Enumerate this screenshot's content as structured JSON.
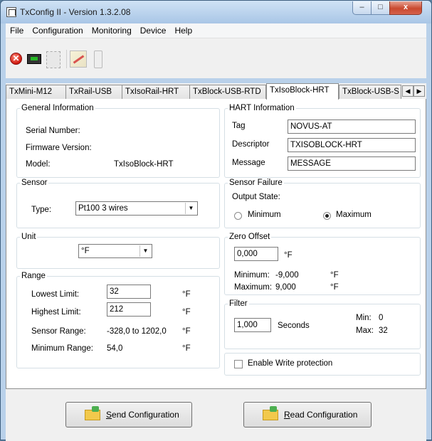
{
  "window": {
    "title": "TxConfig II - Version 1.3.2.08",
    "min_glyph": "–",
    "max_glyph": "□",
    "close_glyph": "x"
  },
  "menu": [
    "File",
    "Configuration",
    "Monitoring",
    "Device",
    "Help"
  ],
  "toolbar": {
    "icons": [
      "stop-icon",
      "monitor-icon",
      "chip-icon",
      "configure-icon",
      "thermometer-icon"
    ],
    "stop_glyph": "✕"
  },
  "tabs": [
    "TxMini-M12",
    "TxRail-USB",
    "TxIsoRail-HRT",
    "TxBlock-USB-RTD",
    "TxIsoBlock-HRT",
    "TxBlock-USB-S"
  ],
  "active_tab": "TxIsoBlock-HRT",
  "scroll": {
    "left": "◀",
    "right": "▶"
  },
  "general": {
    "legend": "General Information",
    "serial_label": "Serial Number:",
    "firmware_label": "Firmware Version:",
    "model_label": "Model:",
    "model_value": "TxIsoBlock-HRT"
  },
  "hart": {
    "legend": "HART Information",
    "tag_label": "Tag",
    "tag_value": "NOVUS-AT",
    "descriptor_label": "Descriptor",
    "descriptor_value": "TXISOBLOCK-HRT",
    "message_label": "Message",
    "message_value": "MESSAGE"
  },
  "sensor": {
    "legend": "Sensor",
    "type_label": "Type:",
    "type_value": "Pt100 3 wires",
    "arrow": "▼"
  },
  "sensor_failure": {
    "legend": "Sensor Failure",
    "output_label": "Output State:",
    "minimum_label": "Minimum",
    "maximum_label": "Maximum",
    "selected": "Maximum"
  },
  "unit": {
    "legend": "Unit",
    "value": "°F",
    "arrow": "▼"
  },
  "zero_offset": {
    "legend": "Zero Offset",
    "value": "0,000",
    "unit": "°F",
    "min_label": "Minimum:",
    "min_value": "-9,000",
    "min_unit": "°F",
    "max_label": "Maximum:",
    "max_value": "9,000",
    "max_unit": "°F"
  },
  "range": {
    "legend": "Range",
    "lowest_label": "Lowest Limit:",
    "lowest_value": "32",
    "lowest_unit": "°F",
    "highest_label": "Highest Limit:",
    "highest_value": "212",
    "highest_unit": "°F",
    "sensor_range_label": "Sensor Range:",
    "sensor_range_value": "-328,0 to 1202,0",
    "sensor_range_unit": "°F",
    "minimum_range_label": "Minimum Range:",
    "minimum_range_value": "54,0",
    "minimum_range_unit": "°F"
  },
  "filter": {
    "legend": "Filter",
    "value": "1,000",
    "seconds_label": "Seconds",
    "min_label": "Min:",
    "min_value": "0",
    "max_label": "Max:",
    "max_value": "32"
  },
  "write_protection": {
    "label": "Enable Write protection",
    "checked": false
  },
  "buttons": {
    "send_first": "S",
    "send_rest": "end Configuration",
    "read_first": "R",
    "read_rest": "ead Configuration"
  }
}
